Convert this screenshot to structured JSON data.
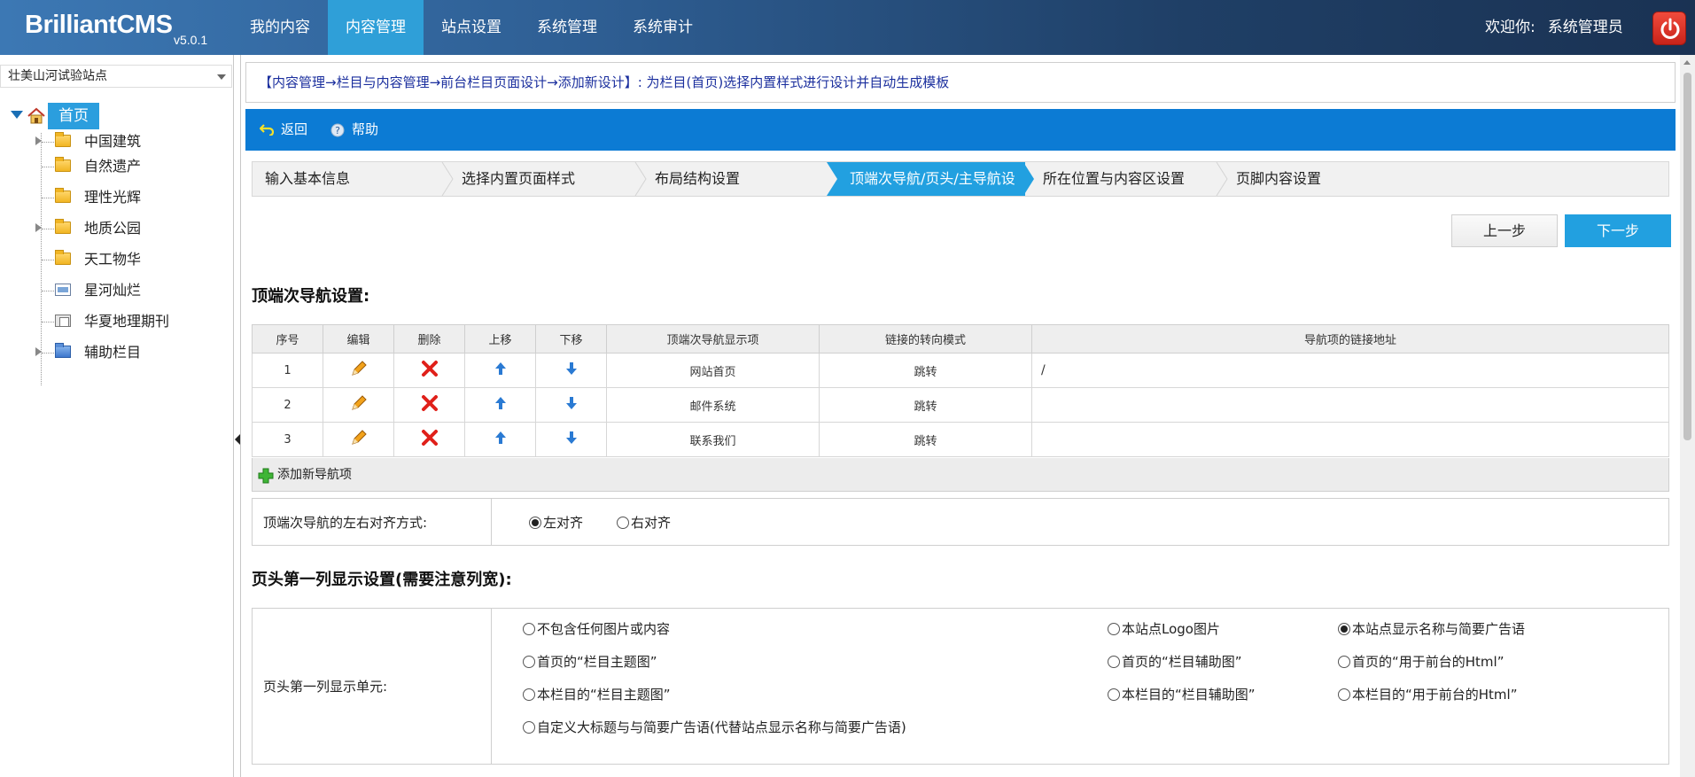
{
  "app": {
    "logo_brilliant": "Brilliant",
    "logo_cms": "CMS",
    "version": "v5.0.1"
  },
  "mainnav": [
    "我的内容",
    "内容管理",
    "站点设置",
    "系统管理",
    "系统审计"
  ],
  "user": {
    "welcome": "欢迎你:",
    "name": "系统管理员"
  },
  "sidebar": {
    "site": "壮美山河试验站点",
    "root": "首页",
    "items": [
      {
        "label": "中国建筑",
        "icon": "folder-icon",
        "expandable": true
      },
      {
        "label": "自然遗产",
        "icon": "folder-icon",
        "expandable": false
      },
      {
        "label": "理性光辉",
        "icon": "folder-icon",
        "expandable": false
      },
      {
        "label": "地质公园",
        "icon": "folder-icon",
        "expandable": true
      },
      {
        "label": "天工物华",
        "icon": "folder-icon",
        "expandable": false
      },
      {
        "label": "星河灿烂",
        "icon": "page-icon",
        "expandable": false
      },
      {
        "label": "华夏地理期刊",
        "icon": "book-icon",
        "expandable": false
      },
      {
        "label": "辅助栏目",
        "icon": "blue-folder-icon",
        "expandable": true
      }
    ]
  },
  "breadcrumb": "【内容管理→栏目与内容管理→前台栏目页面设计→添加新设计】: 为栏目(首页)选择内置样式进行设计并自动生成模板",
  "toolbar": {
    "back": "返回",
    "help": "帮助"
  },
  "steps": [
    "输入基本信息",
    "选择内置页面样式",
    "布局结构设置",
    "顶端次导航/页头/主导航设置",
    "所在位置与内容区设置",
    "页脚内容设置"
  ],
  "buttons": {
    "prev": "上一步",
    "next": "下一步"
  },
  "sec1_title": "顶端次导航设置:",
  "nav_table": {
    "headers": [
      "序号",
      "编辑",
      "删除",
      "上移",
      "下移",
      "顶端次导航显示项",
      "链接的转向模式",
      "导航项的链接地址"
    ],
    "rows": [
      {
        "no": "1",
        "name": "网站首页",
        "mode": "跳转",
        "url": "/"
      },
      {
        "no": "2",
        "name": "邮件系统",
        "mode": "跳转",
        "url": ""
      },
      {
        "no": "3",
        "name": "联系我们",
        "mode": "跳转",
        "url": ""
      }
    ],
    "add": "添加新导航项"
  },
  "align": {
    "label": "顶端次导航的左右对齐方式:",
    "left": "左对齐",
    "right": "右对齐"
  },
  "sec2_title": "页头第一列显示设置(需要注意列宽):",
  "header_col": {
    "label": "页头第一列显示单元:",
    "o1": "不包含任何图片或内容",
    "o2": "本站点Logo图片",
    "o3": "本站点显示名称与简要广告语",
    "o4": "首页的“栏目主题图”",
    "o5": "首页的“栏目辅助图”",
    "o6": "首页的“用于前台的Html”",
    "o7": "本栏目的“栏目主题图”",
    "o8": "本栏目的“栏目辅助图”",
    "o9": "本栏目的“用于前台的Html”",
    "o10": "自定义大标题与与简要广告语(代替站点显示名称与简要广告语)"
  }
}
